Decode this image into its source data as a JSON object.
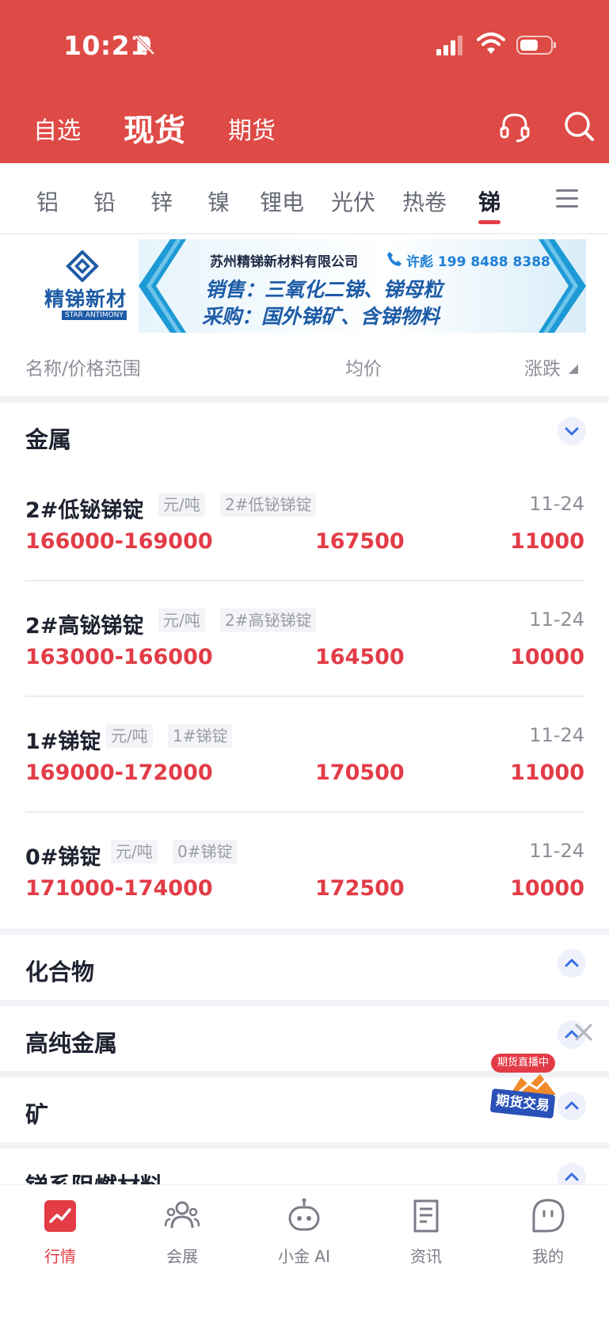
{
  "status_bar": {
    "time": "10:21"
  },
  "header": {
    "tabs": [
      {
        "label": "自选"
      },
      {
        "label": "现货"
      },
      {
        "label": "期货"
      }
    ]
  },
  "categories": [
    "铝",
    "铅",
    "锌",
    "镍",
    "锂电",
    "光伏",
    "热卷",
    "锑"
  ],
  "active_category": "锑",
  "banner": {
    "logo_text": "精锑新材",
    "logo_sub": "STAR ANTIMONY",
    "company": "苏州精锑新材料有限公司",
    "phone": "许彪 199 8488 8388",
    "line1": "销售：三氧化二锑、锑母粒",
    "line2": "采购：国外锑矿、含锑物料"
  },
  "columns": {
    "name": "名称/价格范围",
    "avg": "均价",
    "change": "涨跌"
  },
  "sections": [
    {
      "title": "金属",
      "expanded": true
    },
    {
      "title": "化合物",
      "expanded": false
    },
    {
      "title": "高纯金属",
      "expanded": false
    },
    {
      "title": "矿",
      "expanded": false
    },
    {
      "title": "锑系阻燃材料",
      "expanded": false
    }
  ],
  "rows": [
    {
      "name": "2#低铋锑锭",
      "unit": "元/吨",
      "tag": "2#低铋锑锭",
      "date": "11-24",
      "range": "166000-169000",
      "avg": "167500",
      "change": "11000"
    },
    {
      "name": "2#高铋锑锭",
      "unit": "元/吨",
      "tag": "2#高铋锑锭",
      "date": "11-24",
      "range": "163000-166000",
      "avg": "164500",
      "change": "10000"
    },
    {
      "name": "1#锑锭",
      "unit": "元/吨",
      "tag": "1#锑锭",
      "date": "11-24",
      "range": "169000-172000",
      "avg": "170500",
      "change": "11000"
    },
    {
      "name": "0#锑锭",
      "unit": "元/吨",
      "tag": "0#锑锭",
      "date": "11-24",
      "range": "171000-174000",
      "avg": "172500",
      "change": "10000"
    }
  ],
  "float_ad": {
    "live": "期货直播中",
    "trade": "期货交易"
  },
  "bottom_nav": [
    {
      "label": "行情",
      "icon": "chart-trend-icon",
      "active": true
    },
    {
      "label": "会展",
      "icon": "people-icon",
      "active": false
    },
    {
      "label": "小金 AI",
      "icon": "robot-icon",
      "active": false
    },
    {
      "label": "资讯",
      "icon": "document-icon",
      "active": false
    },
    {
      "label": "我的",
      "icon": "profile-icon",
      "active": false
    }
  ],
  "colors": {
    "header": "#de4a45",
    "price_red": "#e23c47",
    "link_blue": "#3a6fe0"
  }
}
